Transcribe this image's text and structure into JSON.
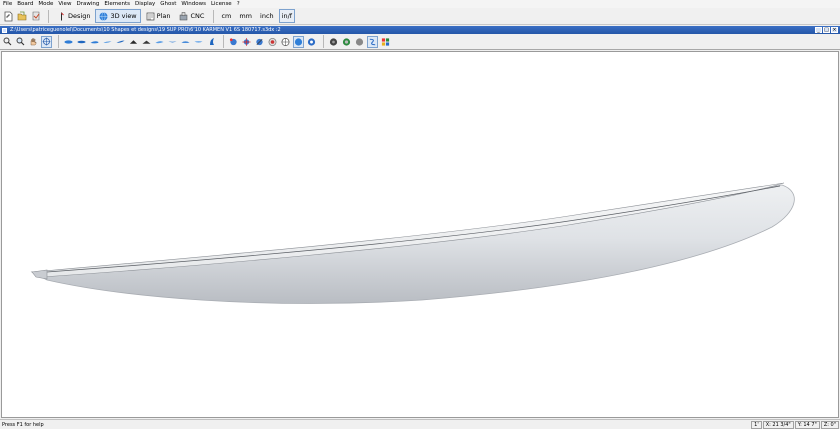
{
  "menu": [
    "File",
    "Board",
    "Mode",
    "View",
    "Drawing",
    "Elements",
    "Display",
    "Ghost",
    "Windows",
    "License",
    "?"
  ],
  "toolbar": {
    "modes": [
      {
        "label": "Design",
        "active": false
      },
      {
        "label": "3D view",
        "active": true
      },
      {
        "label": "Plan",
        "active": false
      },
      {
        "label": "CNC",
        "active": false
      }
    ],
    "units": [
      {
        "label": "cm",
        "active": false
      },
      {
        "label": "mm",
        "active": false
      },
      {
        "label": "inch",
        "active": false
      },
      {
        "label": "in/f",
        "active": true
      }
    ]
  },
  "document": {
    "title": "Z:\\Users\\patriceguenolel\\Documents\\10 Shapes et designs\\19 SUP PRO\\6'10 KARMEN V1 6S 180717.s3dx :2",
    "window_buttons": [
      "_",
      "□",
      "×"
    ]
  },
  "status": {
    "help": "Press F1 for help",
    "cells": [
      "1'",
      "X: 21 3/4\"",
      "Y: 14 7\"",
      "Z: 0\""
    ]
  },
  "colors": {
    "title_bar": "#2f63b8",
    "board_body": "#dfe2e6",
    "board_shadow": "#b9bdc3",
    "board_deck": "#eef0f2"
  }
}
